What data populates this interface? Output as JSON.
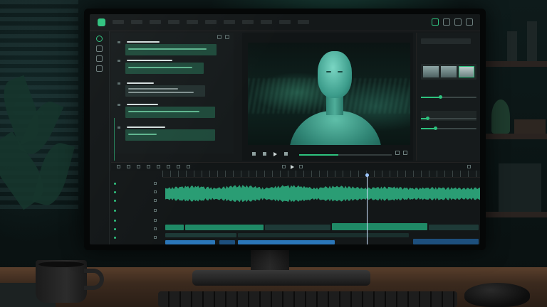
{
  "app": {
    "accent_color": "#2ec27e",
    "menu": [
      "",
      "",
      "",
      "",
      "",
      "",
      "",
      "",
      "",
      "",
      ""
    ]
  },
  "icons": {
    "rail": [
      "play-circle-icon",
      "media-icon",
      "layers-icon",
      "image-icon"
    ],
    "top_right": [
      "frame-icon",
      "export-icon",
      "settings-icon",
      "grid-icon"
    ]
  },
  "transcript": {
    "title": "",
    "segments": [
      {
        "id": 1,
        "highlighted": true
      },
      {
        "id": 2,
        "highlighted": true
      },
      {
        "id": 3,
        "highlighted": false
      },
      {
        "id": 4,
        "highlighted": true
      },
      {
        "id": 5,
        "highlighted": true
      }
    ]
  },
  "viewer": {
    "clip_label": "",
    "timecode": "",
    "progress": 0.42
  },
  "properties": {
    "sections": [
      "",
      "",
      "",
      ""
    ],
    "slider_values": [
      0.35,
      0.12,
      0.25
    ]
  },
  "timeline": {
    "tracks": [
      "",
      "",
      "",
      "",
      "",
      "",
      ""
    ],
    "playhead_fraction": 0.64
  }
}
